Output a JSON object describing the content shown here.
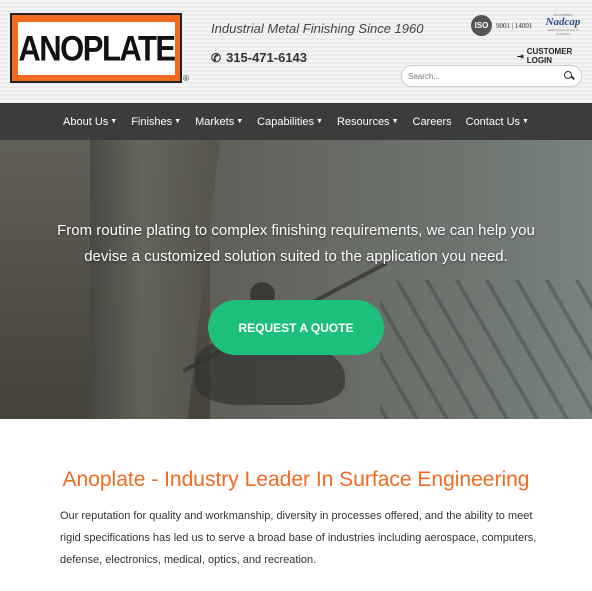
{
  "header": {
    "logo_text": "ANOPLATE",
    "logo_reg": "®",
    "tagline": "Industrial Metal Finishing Since 1960",
    "phone": "315-471-6143",
    "phone_icon": "phone-icon",
    "iso_badge": "ISO",
    "iso_numbers": "9001 | 14001",
    "nadcap_accredited": "Accredited",
    "nadcap_name": "Nadcap",
    "nadcap_sub": "AEROSPACE QUALITY SYSTEMS",
    "customer_login": "CUSTOMER LOGIN",
    "search_placeholder": "Search..."
  },
  "nav": {
    "items": [
      {
        "label": "About Us",
        "dropdown": true
      },
      {
        "label": "Finishes",
        "dropdown": true
      },
      {
        "label": "Markets",
        "dropdown": true
      },
      {
        "label": "Capabilities",
        "dropdown": true
      },
      {
        "label": "Resources",
        "dropdown": true
      },
      {
        "label": "Careers",
        "dropdown": false
      },
      {
        "label": "Contact Us",
        "dropdown": true
      }
    ]
  },
  "hero": {
    "text": "From routine plating to complex finishing requirements, we can help you devise a customized solution suited to the application you need.",
    "button_label": "REQUEST A QUOTE"
  },
  "section": {
    "title": "Anoplate - Industry Leader In Surface Engineering",
    "body": "Our reputation for quality and workmanship, diversity in processes offered, and the ability to meet rigid specifications has led us to serve a broad base of industries including aerospace, computers, defense, electronics, medical, optics, and recreation."
  },
  "colors": {
    "brand_orange": "#f26a21",
    "nav_bg": "#3c3c3c",
    "cta_green": "#1dc07a"
  }
}
